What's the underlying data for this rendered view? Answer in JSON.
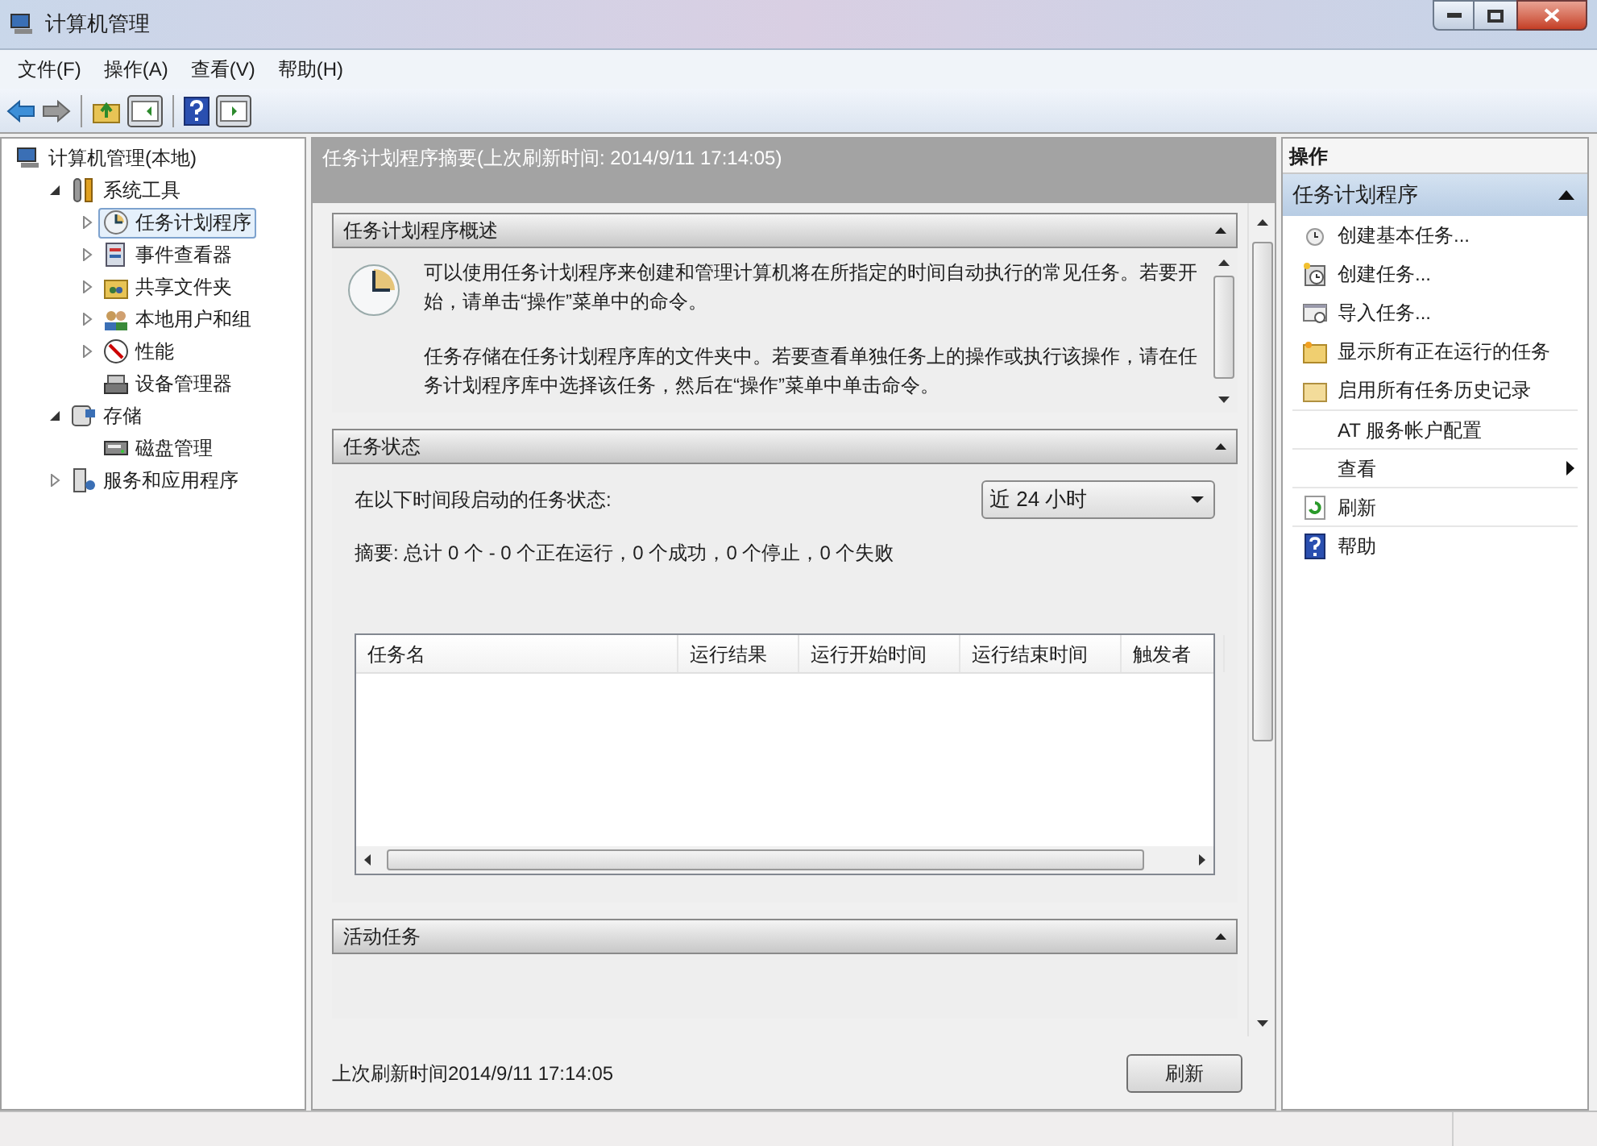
{
  "window": {
    "title": "计算机管理"
  },
  "menu": [
    "文件(F)",
    "操作(A)",
    "查看(V)",
    "帮助(H)"
  ],
  "tree": [
    {
      "label": "计算机管理(本地)",
      "selected": false,
      "children": [
        {
          "label": "系统工具",
          "selected": false,
          "expanded": true,
          "children": [
            {
              "label": "任务计划程序",
              "selected": true,
              "expanded": false
            },
            {
              "label": "事件查看器",
              "selected": false,
              "expanded": false
            },
            {
              "label": "共享文件夹",
              "selected": false,
              "expanded": false
            },
            {
              "label": "本地用户和组",
              "selected": false,
              "expanded": false
            },
            {
              "label": "性能",
              "selected": false,
              "expanded": false
            },
            {
              "label": "设备管理器",
              "selected": false
            }
          ]
        },
        {
          "label": "存储",
          "selected": false,
          "expanded": true,
          "children": [
            {
              "label": "磁盘管理",
              "selected": false
            }
          ]
        },
        {
          "label": "服务和应用程序",
          "selected": false,
          "expanded": false
        }
      ]
    }
  ],
  "summary": {
    "header": "任务计划程序摘要(上次刷新时间: 2014/9/11 17:14:05)",
    "sections": [
      {
        "kind": "overview",
        "title": "任务计划程序概述",
        "expanded": true,
        "paragraphs": [
          "可以使用任务计划程序来创建和管理计算机将在所指定的时间自动执行的常见任务。若要开始，请单击“操作”菜单中的命令。",
          "任务存储在任务计划程序库的文件夹中。若要查看单独任务上的操作或执行该操作，请在任务计划程序库中选择该任务，然后在“操作”菜单中单击命令。"
        ]
      },
      {
        "kind": "status",
        "title": "任务状态",
        "expanded": true,
        "period_label": "在以下时间段启动的任务状态:",
        "period": "近 24 小时",
        "totals": "摘要: 总计 0 个 - 0 个正在运行，0 个成功，0 个停止，0 个失败",
        "columns": [
          "任务名",
          "运行结果",
          "运行开始时间",
          "运行结束时间",
          "触发者"
        ]
      },
      {
        "kind": "active",
        "title": "活动任务",
        "expanded": true
      }
    ],
    "footer": "上次刷新时间2014/9/11 17:14:05",
    "refresh_button": "刷新"
  },
  "actions": {
    "title": "操作",
    "group": "任务计划程序",
    "group_expanded": true,
    "items": [
      {
        "kind": "action",
        "label": "创建基本任务..."
      },
      {
        "kind": "action",
        "label": "创建任务..."
      },
      {
        "kind": "action",
        "label": "导入任务..."
      },
      {
        "kind": "action",
        "label": "显示所有正在运行的任务"
      },
      {
        "kind": "action",
        "label": "启用所有任务历史记录"
      },
      {
        "kind": "plain",
        "label": "AT 服务帐户配置"
      },
      {
        "kind": "submenu",
        "label": "查看"
      },
      {
        "kind": "action",
        "label": "刷新"
      },
      {
        "kind": "action",
        "label": "帮助"
      }
    ]
  }
}
